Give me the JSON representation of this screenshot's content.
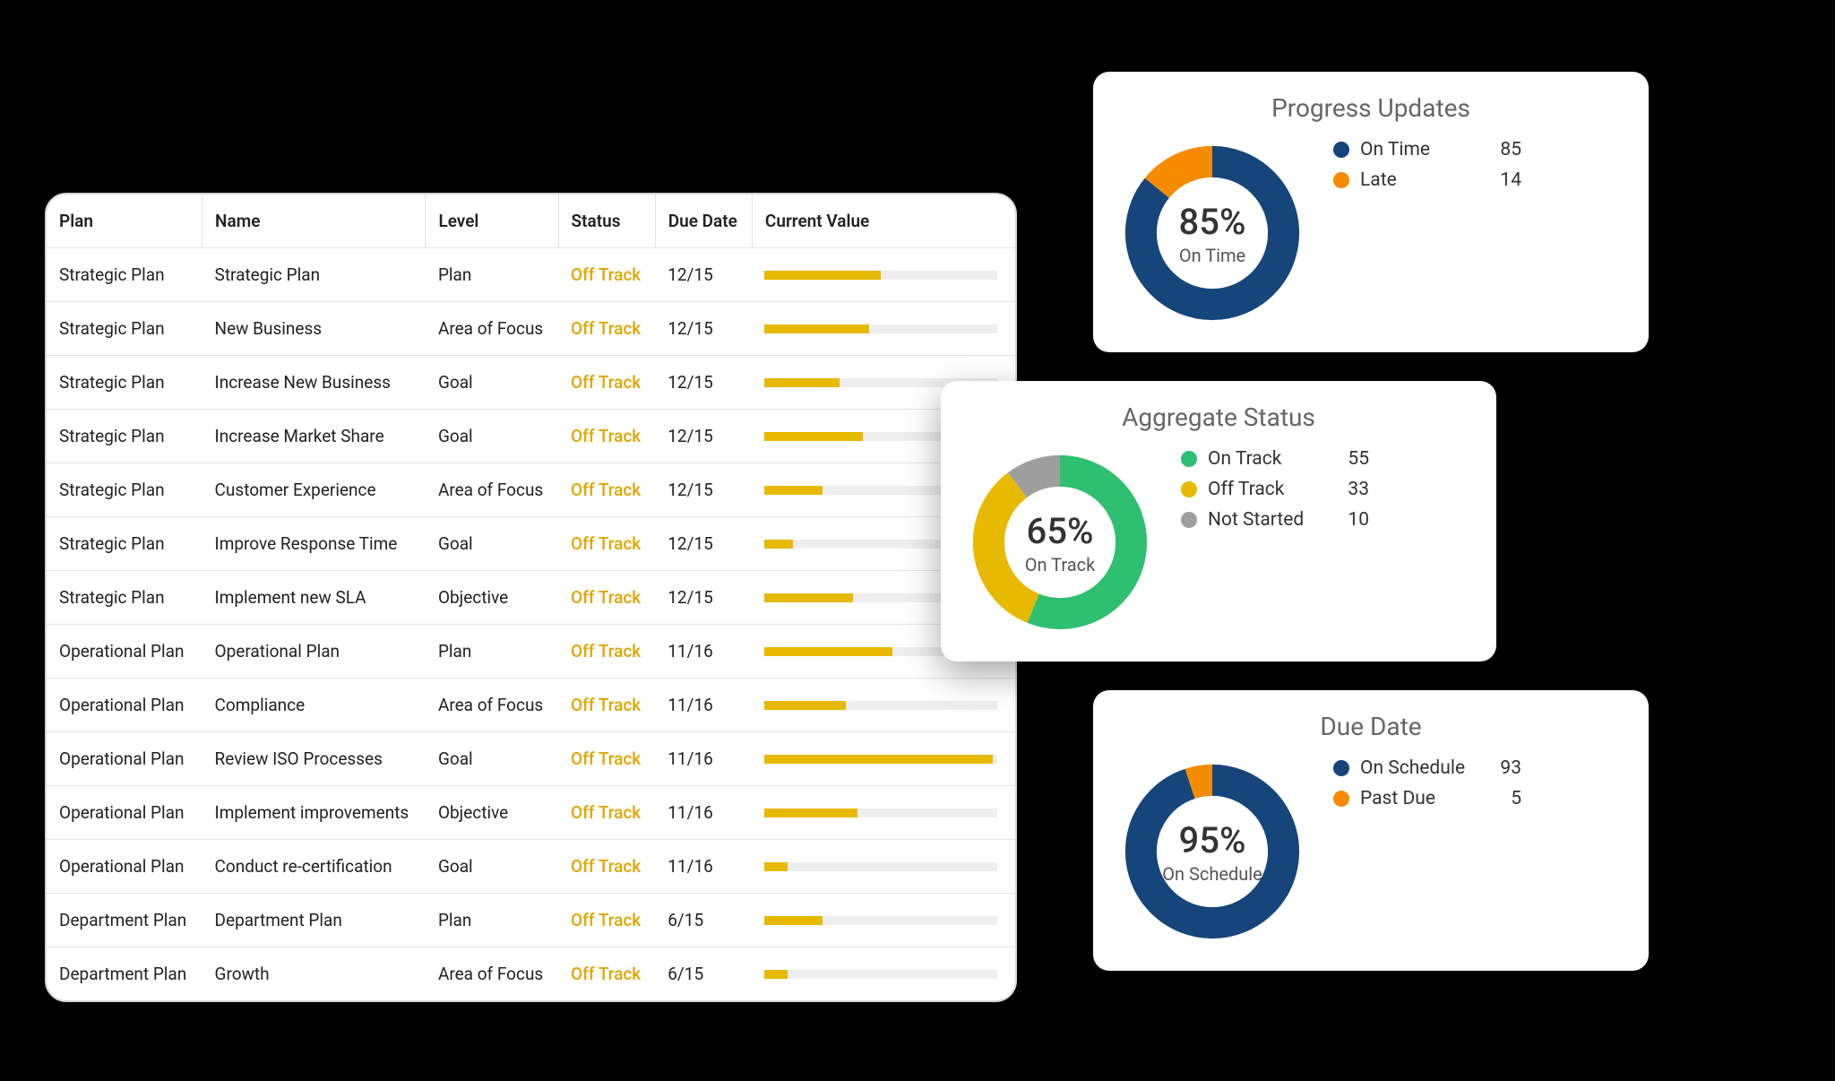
{
  "colors": {
    "blue": "#15457a",
    "orange": "#f58b00",
    "yellow": "#e7b900",
    "green": "#2fbf71",
    "gray": "#9e9e9e"
  },
  "table": {
    "headers": [
      "Plan",
      "Name",
      "Level",
      "Status",
      "Due Date",
      "Current Value"
    ],
    "rows": [
      {
        "plan": "Strategic Plan",
        "name": "Strategic Plan",
        "level": "Plan",
        "status": "Off Track",
        "due": "12/15",
        "pct": 50
      },
      {
        "plan": "Strategic Plan",
        "name": "New Business",
        "level": "Area of Focus",
        "status": "Off Track",
        "due": "12/15",
        "pct": 45
      },
      {
        "plan": "Strategic Plan",
        "name": "Increase New Business",
        "level": "Goal",
        "status": "Off Track",
        "due": "12/15",
        "pct": 32
      },
      {
        "plan": "Strategic Plan",
        "name": "Increase Market Share",
        "level": "Goal",
        "status": "Off Track",
        "due": "12/15",
        "pct": 42
      },
      {
        "plan": "Strategic Plan",
        "name": "Customer Experience",
        "level": "Area of Focus",
        "status": "Off Track",
        "due": "12/15",
        "pct": 25
      },
      {
        "plan": "Strategic Plan",
        "name": "Improve Response Time",
        "level": "Goal",
        "status": "Off Track",
        "due": "12/15",
        "pct": 12
      },
      {
        "plan": "Strategic Plan",
        "name": "Implement new SLA",
        "level": "Objective",
        "status": "Off Track",
        "due": "12/15",
        "pct": 38
      },
      {
        "plan": "Operational Plan",
        "name": "Operational Plan",
        "level": "Plan",
        "status": "Off Track",
        "due": "11/16",
        "pct": 55
      },
      {
        "plan": "Operational Plan",
        "name": "Compliance",
        "level": "Area of Focus",
        "status": "Off Track",
        "due": "11/16",
        "pct": 35
      },
      {
        "plan": "Operational Plan",
        "name": "Review ISO Processes",
        "level": "Goal",
        "status": "Off Track",
        "due": "11/16",
        "pct": 98
      },
      {
        "plan": "Operational Plan",
        "name": "Implement improvements",
        "level": "Objective",
        "status": "Off Track",
        "due": "11/16",
        "pct": 40
      },
      {
        "plan": "Operational Plan",
        "name": "Conduct re-certification",
        "level": "Goal",
        "status": "Off Track",
        "due": "11/16",
        "pct": 10
      },
      {
        "plan": "Department Plan",
        "name": "Department Plan",
        "level": "Plan",
        "status": "Off Track",
        "due": "6/15",
        "pct": 25
      },
      {
        "plan": "Department Plan",
        "name": "Growth",
        "level": "Area of Focus",
        "status": "Off Track",
        "due": "6/15",
        "pct": 10
      }
    ]
  },
  "cards": {
    "progress": {
      "title": "Progress Updates",
      "center_pct": "85%",
      "center_label": "On Time",
      "legend": [
        {
          "label": "On Time",
          "value": 85,
          "color": "blue"
        },
        {
          "label": "Late",
          "value": 14,
          "color": "orange"
        }
      ]
    },
    "aggregate": {
      "title": "Aggregate Status",
      "center_pct": "65%",
      "center_label": "On Track",
      "legend": [
        {
          "label": "On Track",
          "value": 55,
          "color": "green"
        },
        {
          "label": "Off Track",
          "value": 33,
          "color": "yellow"
        },
        {
          "label": "Not Started",
          "value": 10,
          "color": "gray"
        }
      ]
    },
    "due": {
      "title": "Due Date",
      "center_pct": "95%",
      "center_label": "On Schedule",
      "legend": [
        {
          "label": "On Schedule",
          "value": 93,
          "color": "blue"
        },
        {
          "label": "Past Due",
          "value": 5,
          "color": "orange"
        }
      ]
    }
  },
  "chart_data": [
    {
      "type": "pie",
      "title": "Progress Updates",
      "series": [
        {
          "name": "On Time",
          "value": 85
        },
        {
          "name": "Late",
          "value": 14
        }
      ],
      "center_value": 85,
      "center_label": "On Time"
    },
    {
      "type": "pie",
      "title": "Aggregate Status",
      "series": [
        {
          "name": "On Track",
          "value": 55
        },
        {
          "name": "Off Track",
          "value": 33
        },
        {
          "name": "Not Started",
          "value": 10
        }
      ],
      "center_value": 65,
      "center_label": "On Track"
    },
    {
      "type": "pie",
      "title": "Due Date",
      "series": [
        {
          "name": "On Schedule",
          "value": 93
        },
        {
          "name": "Past Due",
          "value": 5
        }
      ],
      "center_value": 95,
      "center_label": "On Schedule"
    }
  ]
}
